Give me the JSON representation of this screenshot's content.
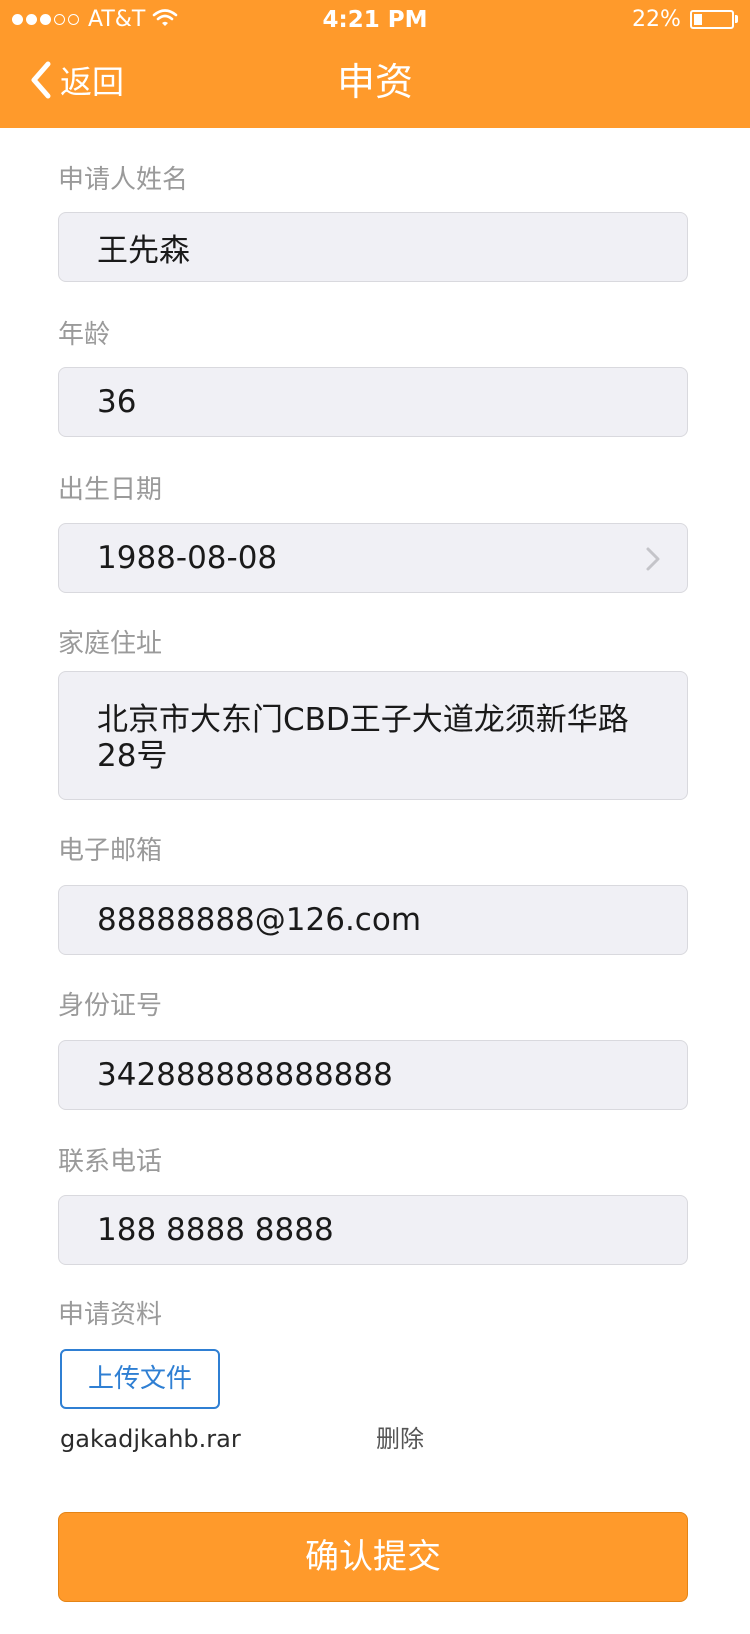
{
  "status_bar": {
    "carrier": "AT&T",
    "time": "4:21 PM",
    "battery_percent": "22%",
    "battery_level": 0.22,
    "signal_bars_filled": 3,
    "signal_bars_total": 5
  },
  "nav": {
    "back_label": "返回",
    "title": "申资",
    "icon": "chevron-left-icon"
  },
  "form": {
    "name": {
      "label": "申请人姓名",
      "value": "王先森"
    },
    "age": {
      "label": "年龄",
      "value": "36"
    },
    "birthdate": {
      "label": "出生日期",
      "value": "1988-08-08",
      "icon": "chevron-right-icon"
    },
    "address": {
      "label": "家庭住址",
      "value": "北京市大东门CBD王子大道龙须新华路28号"
    },
    "email": {
      "label": "电子邮箱",
      "value": "88888888@126.com"
    },
    "id_number": {
      "label": "身份证号",
      "value": "342888888888888"
    },
    "phone": {
      "label": "联系电话",
      "value": "188 8888 8888"
    },
    "materials": {
      "label": "申请资料",
      "upload_label": "上传文件",
      "file_name": "gakadjkahb.rar",
      "delete_label": "删除"
    }
  },
  "submit_label": "确认提交",
  "colors": {
    "brand_orange": "#FF9A2B",
    "link_blue": "#2F7FD3",
    "label_gray": "#9A9A9A",
    "field_bg": "#F0F0F5"
  }
}
